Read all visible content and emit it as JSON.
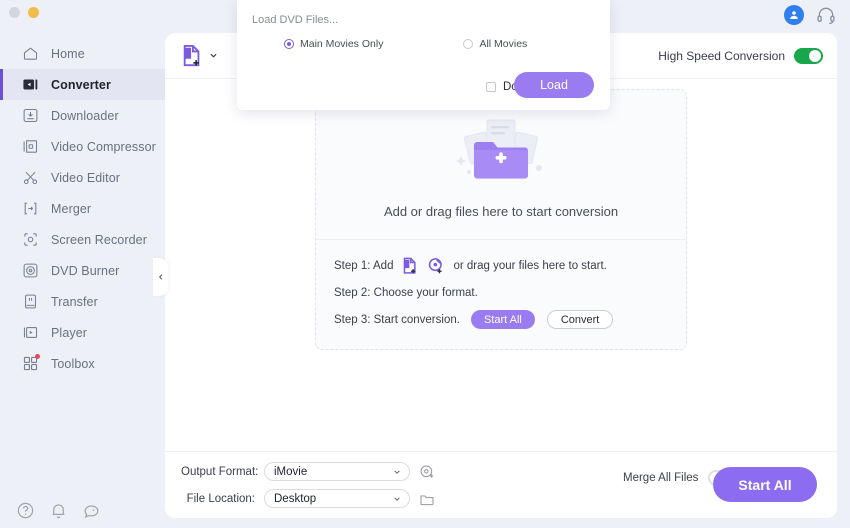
{
  "window": {
    "traffic_lights": [
      "close",
      "minimize"
    ]
  },
  "topbar": {
    "avatar_icon": "user-avatar-icon",
    "support_icon": "headset-support-icon"
  },
  "sidebar": {
    "items": [
      {
        "label": "Home",
        "icon": "home-icon",
        "active": false,
        "badge": false
      },
      {
        "label": "Converter",
        "icon": "converter-icon",
        "active": true,
        "badge": false
      },
      {
        "label": "Downloader",
        "icon": "download-icon",
        "active": false,
        "badge": false
      },
      {
        "label": "Video Compressor",
        "icon": "compress-icon",
        "active": false,
        "badge": false
      },
      {
        "label": "Video Editor",
        "icon": "scissors-icon",
        "active": false,
        "badge": false
      },
      {
        "label": "Merger",
        "icon": "merge-icon",
        "active": false,
        "badge": false
      },
      {
        "label": "Screen Recorder",
        "icon": "screen-record-icon",
        "active": false,
        "badge": false
      },
      {
        "label": "DVD Burner",
        "icon": "disc-burn-icon",
        "active": false,
        "badge": false
      },
      {
        "label": "Transfer",
        "icon": "transfer-icon",
        "active": false,
        "badge": false
      },
      {
        "label": "Player",
        "icon": "player-icon",
        "active": false,
        "badge": false
      },
      {
        "label": "Toolbox",
        "icon": "toolbox-icon",
        "active": false,
        "badge": true
      }
    ],
    "footer_icons": [
      "help-circle-icon",
      "bell-icon",
      "feedback-icon"
    ],
    "collapse_icon": "chevron-left-icon"
  },
  "header": {
    "add_file_icon": "add-file-icon",
    "add_file_caret": "chevron-down-icon",
    "high_speed_label": "High Speed Conversion",
    "high_speed_on": true
  },
  "dropzone": {
    "folder_icon": "folder-plus-illustration",
    "caption": "Add or drag files here to start conversion",
    "steps": [
      {
        "prefix": "Step 1: Add",
        "icons": [
          "add-file-icon",
          "add-disc-icon"
        ],
        "suffix": "or drag your files here to start."
      },
      {
        "prefix": "Step 2: Choose your format."
      },
      {
        "prefix": "Step 3: Start conversion.",
        "buttons": [
          {
            "label": "Start  All",
            "style": "filled"
          },
          {
            "label": "Convert",
            "style": "outline"
          }
        ]
      }
    ]
  },
  "bottombar": {
    "output_format_label": "Output Format:",
    "output_format_value": "iMovie",
    "file_location_label": "File Location:",
    "file_location_value": "Desktop",
    "settings_icon": "settings-gear-icon",
    "folder_icon": "folder-open-icon",
    "merge_label": "Merge All Files",
    "merge_on": false,
    "start_all_label": "Start All"
  },
  "dialog": {
    "title": "Load DVD Files...",
    "options": [
      {
        "label": "Main Movies Only",
        "selected": true
      },
      {
        "label": "All Movies",
        "selected": false
      }
    ],
    "dont_show_label": "Don't show again",
    "dont_show_checked": false,
    "load_label": "Load"
  },
  "colors": {
    "accent_purple": "#8c6cf0",
    "pill_purple": "#9b7cf0",
    "toggle_green": "#1aa64b",
    "avatar_blue": "#2f80ed",
    "sidebar_bg": "#eef0f8",
    "badge_red": "#e04a59"
  }
}
